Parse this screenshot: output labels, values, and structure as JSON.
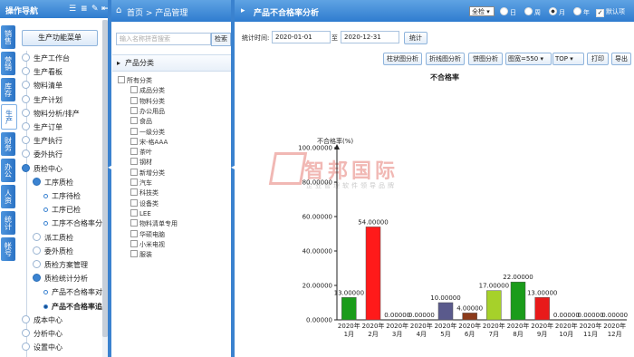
{
  "left_nav": {
    "title": "操作导航",
    "header_icons": [
      "list-icon",
      "menu-icon",
      "tools-icon",
      "collapse-icon"
    ],
    "vertical_tabs": [
      "销售",
      "营销",
      "库存",
      "生产",
      "财务",
      "办公",
      "人资",
      "统计",
      "帐号"
    ],
    "active_tab": "生产",
    "menu_button": "生产功能菜单",
    "items": [
      {
        "label": "生产工作台",
        "level": 1
      },
      {
        "label": "生产看板",
        "level": 1
      },
      {
        "label": "物料清单",
        "level": 1
      },
      {
        "label": "生产计划",
        "level": 1
      },
      {
        "label": "物料分析/排产",
        "level": 1
      },
      {
        "label": "生产订单",
        "level": 1
      },
      {
        "label": "生产执行",
        "level": 1
      },
      {
        "label": "委外执行",
        "level": 1
      },
      {
        "label": "质检中心",
        "level": 1,
        "open": true
      },
      {
        "label": "工序质检",
        "level": 2,
        "open": true
      },
      {
        "label": "工序待检",
        "level": 3
      },
      {
        "label": "工序已检",
        "level": 3
      },
      {
        "label": "工序不合格率分",
        "level": 3
      },
      {
        "label": "派工质检",
        "level": 2
      },
      {
        "label": "委外质检",
        "level": 2
      },
      {
        "label": "质检方案管理",
        "level": 2
      },
      {
        "label": "质检统计分析",
        "level": 2,
        "open": true
      },
      {
        "label": "产品不合格率对",
        "level": 3
      },
      {
        "label": "产品不合格率追",
        "level": 3,
        "selected": true
      },
      {
        "label": "成本中心",
        "level": 1
      },
      {
        "label": "分析中心",
        "level": 1
      },
      {
        "label": "设置中心",
        "level": 1
      }
    ]
  },
  "breadcrumb": {
    "home": "首页",
    "sep": ">",
    "current": "产品管理"
  },
  "mid": {
    "search_placeholder": "输入名称拼音搜索",
    "search_button": "检索",
    "category_header": "产品分类",
    "categories": [
      "所有分类",
      "成品分类",
      "物料分类",
      "办公用品",
      "食品",
      "一级分类",
      "宋-格AAA",
      "茶叶",
      "钢材",
      "新增分类",
      "汽车",
      "科技类",
      "设备类",
      "LEE",
      "物料清单专用",
      "华硕电脑",
      "小米电视",
      "服装"
    ]
  },
  "page": {
    "title": "产品不合格率分析",
    "period_select": "全检",
    "radios": [
      "日",
      "周",
      "月",
      "年"
    ],
    "selected_radio": "月",
    "default_checkbox": "默认项",
    "stat_time_label": "统计时间:",
    "date_from": "2020-01-01",
    "date_sep": "至",
    "date_to": "2020-12-31",
    "stat_button": "统计",
    "toolbar": {
      "bar": "柱状图分析",
      "line": "折线图分析",
      "pie": "饼图分析",
      "width_select": "图宽=550",
      "top_select": "TOP",
      "print": "打印",
      "export": "导出"
    }
  },
  "watermark": {
    "brand": "智邦国际",
    "slogan": "企业管理软件领导品牌"
  },
  "colors": {
    "header_blue": "#2f7ccf",
    "bar_colors": [
      "#1a9c1a",
      "#ff1a1a",
      "#888888",
      "#888888",
      "#5a5a8c",
      "#8b3a1a",
      "#a6d12a",
      "#1a9c1a",
      "#e81a1a",
      "#888888",
      "#888888",
      "#888888"
    ]
  },
  "chart_data": {
    "type": "bar",
    "title": "不合格率",
    "ylabel": "不合格率(%)",
    "categories": [
      "2020年1月",
      "2020年2月",
      "2020年3月",
      "2020年4月",
      "2020年5月",
      "2020年6月",
      "2020年7月",
      "2020年8月",
      "2020年9月",
      "2020年10月",
      "2020年11月",
      "2020年12月"
    ],
    "values": [
      13,
      54,
      0,
      0,
      10,
      4,
      17,
      22,
      13,
      0,
      0,
      0
    ],
    "data_labels": [
      "13.00000",
      "54.00000",
      "0.00000",
      "0.00000",
      "10.00000",
      "4.00000",
      "17.00000",
      "22.00000",
      "13.00000",
      "0.00000",
      "0.00000",
      "0.00000"
    ],
    "y_ticks": [
      0,
      20,
      40,
      60,
      80,
      100
    ],
    "y_tick_labels": [
      "0.00000",
      "20.00000",
      "40.00000",
      "60.00000",
      "80.00000",
      "100.00000"
    ],
    "ylim": [
      0,
      100
    ]
  }
}
